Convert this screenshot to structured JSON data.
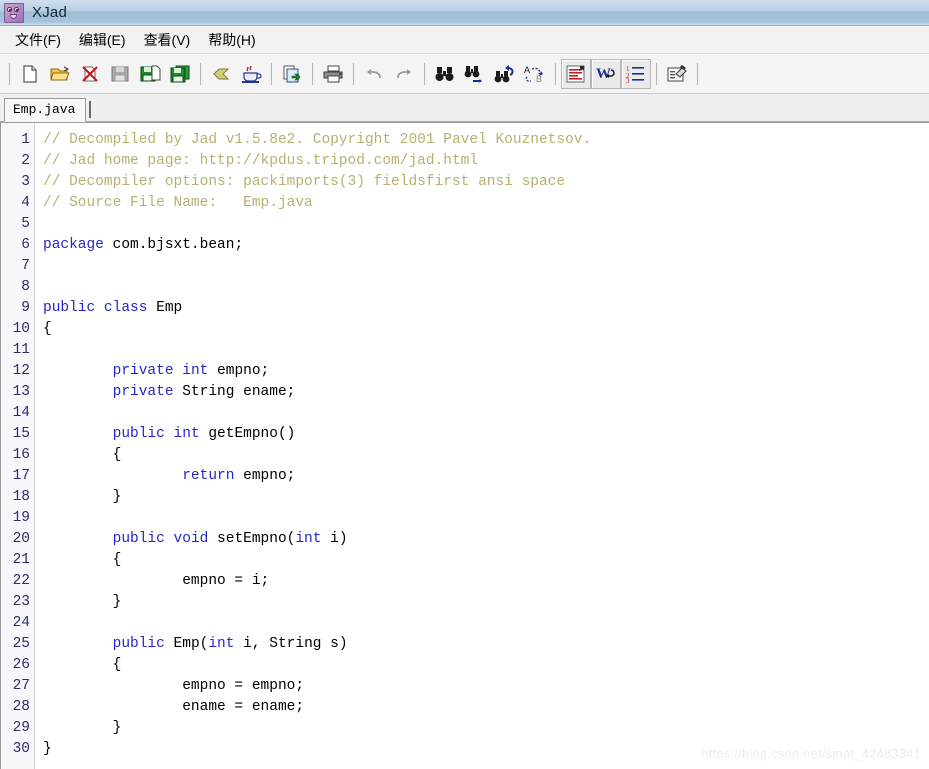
{
  "window": {
    "title": "XJad",
    "icon": "xjad-face-icon"
  },
  "menubar": {
    "items": [
      {
        "label": "文件(F)",
        "name": "menu-file"
      },
      {
        "label": "编辑(E)",
        "name": "menu-edit"
      },
      {
        "label": "查看(V)",
        "name": "menu-view"
      },
      {
        "label": "帮助(H)",
        "name": "menu-help"
      }
    ]
  },
  "toolbar": {
    "buttons": [
      {
        "name": "new-file-icon",
        "tip": "New",
        "pressed": false
      },
      {
        "name": "open-folder-icon",
        "tip": "Open",
        "pressed": false
      },
      {
        "name": "close-file-icon",
        "tip": "Close",
        "pressed": false
      },
      {
        "name": "save-disabled-icon",
        "tip": "Save",
        "pressed": false
      },
      {
        "name": "save-as-icon",
        "tip": "Save As",
        "pressed": false
      },
      {
        "name": "save-all-icon",
        "tip": "Save All",
        "pressed": false
      },
      {
        "name": "decompile-icon",
        "tip": "Decompile",
        "pressed": false
      },
      {
        "name": "java-coffee-icon",
        "tip": "Java",
        "pressed": false
      },
      {
        "name": "copy-to-icon",
        "tip": "Copy",
        "pressed": false
      },
      {
        "name": "print-icon",
        "tip": "Print",
        "pressed": false
      },
      {
        "name": "undo-icon",
        "tip": "Undo",
        "pressed": false
      },
      {
        "name": "redo-icon",
        "tip": "Redo",
        "pressed": false
      },
      {
        "name": "find-icon",
        "tip": "Find",
        "pressed": false
      },
      {
        "name": "find-next-icon",
        "tip": "Find Next",
        "pressed": false
      },
      {
        "name": "find-previous-icon",
        "tip": "Find Previous",
        "pressed": false
      },
      {
        "name": "replace-icon",
        "tip": "Replace",
        "pressed": false
      },
      {
        "name": "format-text-icon",
        "tip": "Format",
        "pressed": true
      },
      {
        "name": "word-wrap-icon",
        "tip": "Word Wrap",
        "pressed": true
      },
      {
        "name": "line-numbers-icon",
        "tip": "Line Numbers",
        "pressed": true
      },
      {
        "name": "options-icon",
        "tip": "Options",
        "pressed": false
      }
    ]
  },
  "tabs": {
    "items": [
      {
        "label": "Emp.java",
        "name": "tab-emp-java",
        "active": true
      }
    ]
  },
  "editor": {
    "line_count": 30,
    "lines": [
      {
        "n": 1,
        "tokens": [
          {
            "t": "// Decompiled by Jad v1.5.8e2. Copyright 2001 Pavel Kouznetsov.",
            "c": "cm"
          }
        ]
      },
      {
        "n": 2,
        "tokens": [
          {
            "t": "// Jad home page: http://kpdus.tripod.com/jad.html",
            "c": "cm"
          }
        ]
      },
      {
        "n": 3,
        "tokens": [
          {
            "t": "// Decompiler options: packimports(3) fieldsfirst ansi space",
            "c": "cm"
          }
        ]
      },
      {
        "n": 4,
        "tokens": [
          {
            "t": "// Source File Name:   Emp.java",
            "c": "cm"
          }
        ]
      },
      {
        "n": 5,
        "tokens": []
      },
      {
        "n": 6,
        "tokens": [
          {
            "t": "package",
            "c": "k"
          },
          {
            "t": " com.bjsxt.bean;",
            "c": "id"
          }
        ]
      },
      {
        "n": 7,
        "tokens": []
      },
      {
        "n": 8,
        "tokens": []
      },
      {
        "n": 9,
        "tokens": [
          {
            "t": "public class",
            "c": "k"
          },
          {
            "t": " Emp",
            "c": "id"
          }
        ]
      },
      {
        "n": 10,
        "tokens": [
          {
            "t": "{",
            "c": "id"
          }
        ]
      },
      {
        "n": 11,
        "tokens": []
      },
      {
        "n": 12,
        "tokens": [
          {
            "t": "        ",
            "c": "id"
          },
          {
            "t": "private int",
            "c": "k"
          },
          {
            "t": " empno;",
            "c": "id"
          }
        ]
      },
      {
        "n": 13,
        "tokens": [
          {
            "t": "        ",
            "c": "id"
          },
          {
            "t": "private",
            "c": "k"
          },
          {
            "t": " String ename;",
            "c": "id"
          }
        ]
      },
      {
        "n": 14,
        "tokens": []
      },
      {
        "n": 15,
        "tokens": [
          {
            "t": "        ",
            "c": "id"
          },
          {
            "t": "public int",
            "c": "k"
          },
          {
            "t": " getEmpno()",
            "c": "id"
          }
        ]
      },
      {
        "n": 16,
        "tokens": [
          {
            "t": "        {",
            "c": "id"
          }
        ]
      },
      {
        "n": 17,
        "tokens": [
          {
            "t": "                ",
            "c": "id"
          },
          {
            "t": "return",
            "c": "k"
          },
          {
            "t": " empno;",
            "c": "id"
          }
        ]
      },
      {
        "n": 18,
        "tokens": [
          {
            "t": "        }",
            "c": "id"
          }
        ]
      },
      {
        "n": 19,
        "tokens": []
      },
      {
        "n": 20,
        "tokens": [
          {
            "t": "        ",
            "c": "id"
          },
          {
            "t": "public void",
            "c": "k"
          },
          {
            "t": " setEmpno(",
            "c": "id"
          },
          {
            "t": "int",
            "c": "k"
          },
          {
            "t": " i)",
            "c": "id"
          }
        ]
      },
      {
        "n": 21,
        "tokens": [
          {
            "t": "        {",
            "c": "id"
          }
        ]
      },
      {
        "n": 22,
        "tokens": [
          {
            "t": "                empno = i;",
            "c": "id"
          }
        ]
      },
      {
        "n": 23,
        "tokens": [
          {
            "t": "        }",
            "c": "id"
          }
        ]
      },
      {
        "n": 24,
        "tokens": []
      },
      {
        "n": 25,
        "tokens": [
          {
            "t": "        ",
            "c": "id"
          },
          {
            "t": "public",
            "c": "k"
          },
          {
            "t": " Emp(",
            "c": "id"
          },
          {
            "t": "int",
            "c": "k"
          },
          {
            "t": " i, String s)",
            "c": "id"
          }
        ]
      },
      {
        "n": 26,
        "tokens": [
          {
            "t": "        {",
            "c": "id"
          }
        ]
      },
      {
        "n": 27,
        "tokens": [
          {
            "t": "                empno = empno;",
            "c": "id"
          }
        ]
      },
      {
        "n": 28,
        "tokens": [
          {
            "t": "                ename = ename;",
            "c": "id"
          }
        ]
      },
      {
        "n": 29,
        "tokens": [
          {
            "t": "        }",
            "c": "id"
          }
        ]
      },
      {
        "n": 30,
        "tokens": [
          {
            "t": "}",
            "c": "id"
          }
        ]
      }
    ]
  },
  "watermark": {
    "text": "https://blog.csdn.net/sinat_42483341"
  },
  "colors": {
    "keyword": "#2727c8",
    "comment": "#b8b070",
    "identifier": "#000000",
    "gutter_number": "#2d2d6e",
    "titlebar_blue": "#9fbdd8"
  }
}
